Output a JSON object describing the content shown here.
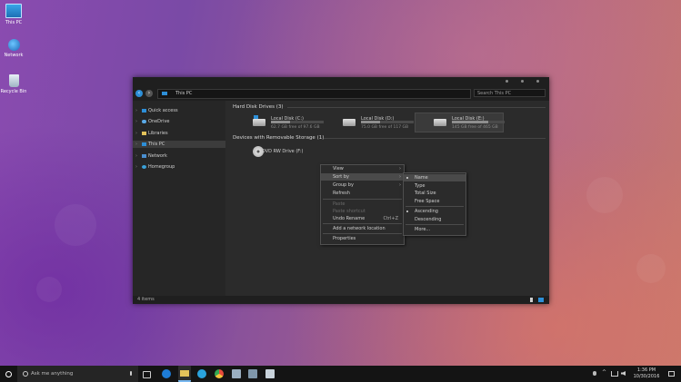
{
  "desktop": {
    "icons": [
      {
        "label": "This PC",
        "icon": "computer-icon"
      },
      {
        "label": "Network",
        "icon": "network-icon"
      },
      {
        "label": "Recycle Bin",
        "icon": "recycle-bin-icon"
      }
    ]
  },
  "window": {
    "address": "This PC",
    "search_placeholder": "Search This PC",
    "sidebar": [
      {
        "label": "Quick access",
        "icon": "star-icon"
      },
      {
        "label": "OneDrive",
        "icon": "cloud-icon"
      },
      {
        "label": "Libraries",
        "icon": "folder-icon"
      },
      {
        "label": "This PC",
        "icon": "computer-icon"
      },
      {
        "label": "Network",
        "icon": "network-icon"
      },
      {
        "label": "Homegroup",
        "icon": "homegroup-icon"
      }
    ],
    "groups": {
      "hard_disks": "Hard Disk Drives (3)",
      "removable": "Devices with Removable Storage (1)"
    },
    "drives": [
      {
        "name": "Local Disk (C:)",
        "free": "62.7 GB free of 97.6 GB",
        "used_fraction": 0.36
      },
      {
        "name": "Local Disk (D:)",
        "free": "75.0 GB free of 117 GB",
        "used_fraction": 0.36
      },
      {
        "name": "Local Disk (E:)",
        "free": "145 GB free of 465 GB",
        "used_fraction": 0.69
      }
    ],
    "dvd": {
      "name": "DVD RW Drive (F:)"
    },
    "status": "4 items"
  },
  "context_menu": {
    "items": [
      {
        "label": "View",
        "submenu": true
      },
      {
        "label": "Sort by",
        "submenu": true
      },
      {
        "label": "Group by",
        "submenu": true
      },
      {
        "label": "Refresh"
      },
      {
        "label": "Paste"
      },
      {
        "label": "Paste shortcut"
      },
      {
        "label": "Undo Rename",
        "shortcut": "Ctrl+Z"
      },
      {
        "label": "Add a network location"
      },
      {
        "label": "Properties"
      }
    ]
  },
  "sort_menu": {
    "items": [
      {
        "label": "Name"
      },
      {
        "label": "Type"
      },
      {
        "label": "Total Size"
      },
      {
        "label": "Free Space"
      },
      {
        "label": "Ascending"
      },
      {
        "label": "Descending"
      },
      {
        "label": "More..."
      }
    ]
  },
  "taskbar": {
    "search_placeholder": "Ask me anything",
    "time": "1:36 PM",
    "date": "10/30/2016"
  },
  "colors": {
    "accent": "#2d8fd8",
    "window_bg": "#2b2b2b",
    "menu_highlight": "#4a4a4a"
  }
}
